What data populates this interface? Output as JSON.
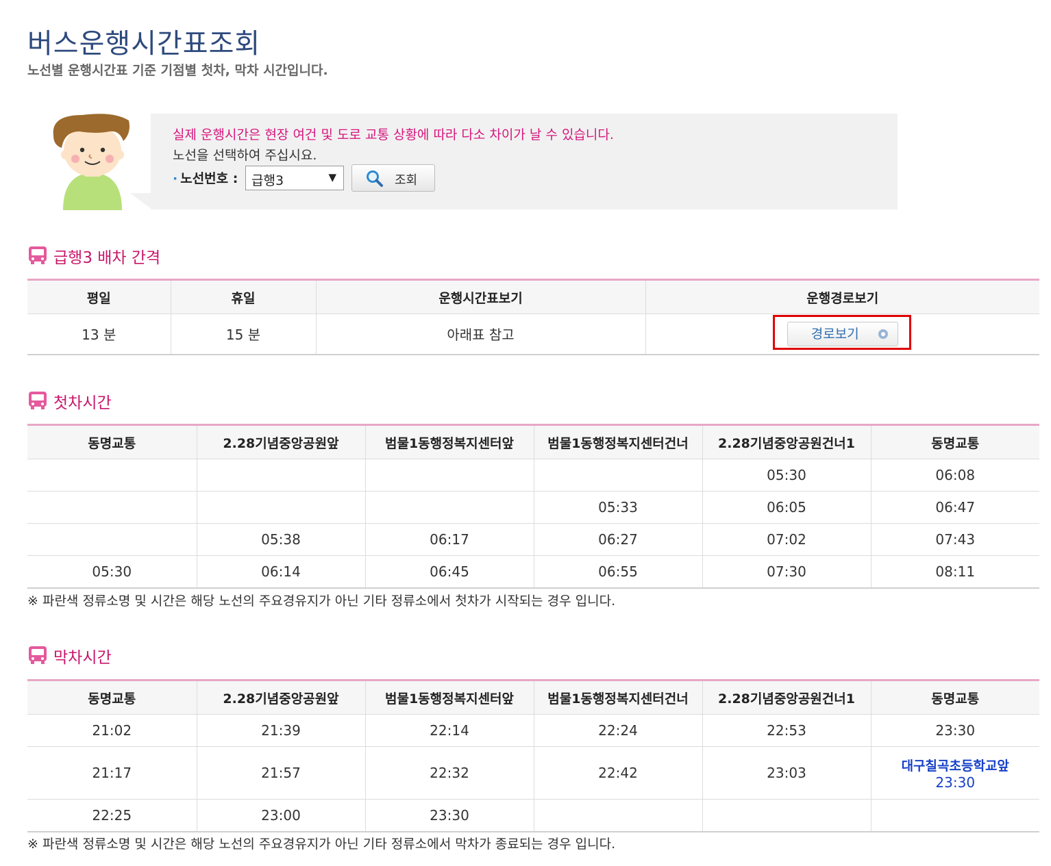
{
  "page": {
    "title": "버스운행시간표조회",
    "subtitle": "노선별 운행시간표 기준 기점별 첫차, 막차 시간입니다."
  },
  "search": {
    "notice": "실제 운행시간은 현장 여건 및 도로 교통 상황에 따라 다소 차이가 날 수 있습니다.",
    "guide": "노선을 선택하여 주십시요.",
    "route_label": "노선번호 :",
    "route_value": "급행3",
    "search_button": "조회"
  },
  "interval": {
    "title": "급행3 배차 간격",
    "headers": [
      "평일",
      "휴일",
      "운행시간표보기",
      "운행경로보기"
    ],
    "weekday": "13 분",
    "holiday": "15 분",
    "timetable": "아래표 참고",
    "route_button": "경로보기"
  },
  "first_bus": {
    "title": "첫차시간",
    "headers": [
      "동명교통",
      "2.28기념중앙공원앞",
      "범물1동행정복지센터앞",
      "범물1동행정복지센터건너",
      "2.28기념중앙공원건너1",
      "동명교통"
    ],
    "rows": [
      [
        "",
        "",
        "",
        "",
        "05:30",
        "06:08"
      ],
      [
        "",
        "",
        "",
        "05:33",
        "06:05",
        "06:47"
      ],
      [
        "",
        "05:38",
        "06:17",
        "06:27",
        "07:02",
        "07:43"
      ],
      [
        "05:30",
        "06:14",
        "06:45",
        "06:55",
        "07:30",
        "08:11"
      ]
    ],
    "note": "※ 파란색 정류소명 및 시간은 해당 노선의 주요경유지가 아닌 기타 정류소에서 첫차가 시작되는 경우 입니다."
  },
  "last_bus": {
    "title": "막차시간",
    "headers": [
      "동명교통",
      "2.28기념중앙공원앞",
      "범물1동행정복지센터앞",
      "범물1동행정복지센터건너",
      "2.28기념중앙공원건너1",
      "동명교통"
    ],
    "rows": [
      [
        "21:02",
        "21:39",
        "22:14",
        "22:24",
        "22:53",
        "23:30"
      ],
      [
        "21:17",
        "21:57",
        "22:32",
        "22:42",
        "23:03",
        ""
      ],
      [
        "22:25",
        "23:00",
        "23:30",
        "",
        "",
        ""
      ]
    ],
    "special_stop": "대구칠곡초등학교앞",
    "special_time": "23:30",
    "note": "※ 파란색 정류소명 및 시간은 해당 노선의 주요경유지가 아닌 기타 정류소에서 막차가 종료되는 경우 입니다."
  },
  "colors": {
    "title": "#2e4a7d",
    "accent_pink": "#c8166a",
    "notice_pink": "#d6177e",
    "table_top_border": "#e9a6c6",
    "special_blue": "#1640c8",
    "highlight_red": "#e00000"
  },
  "icons": [
    "mascot-illustration",
    "search-icon",
    "bus-icon",
    "arrow-circle-icon"
  ]
}
